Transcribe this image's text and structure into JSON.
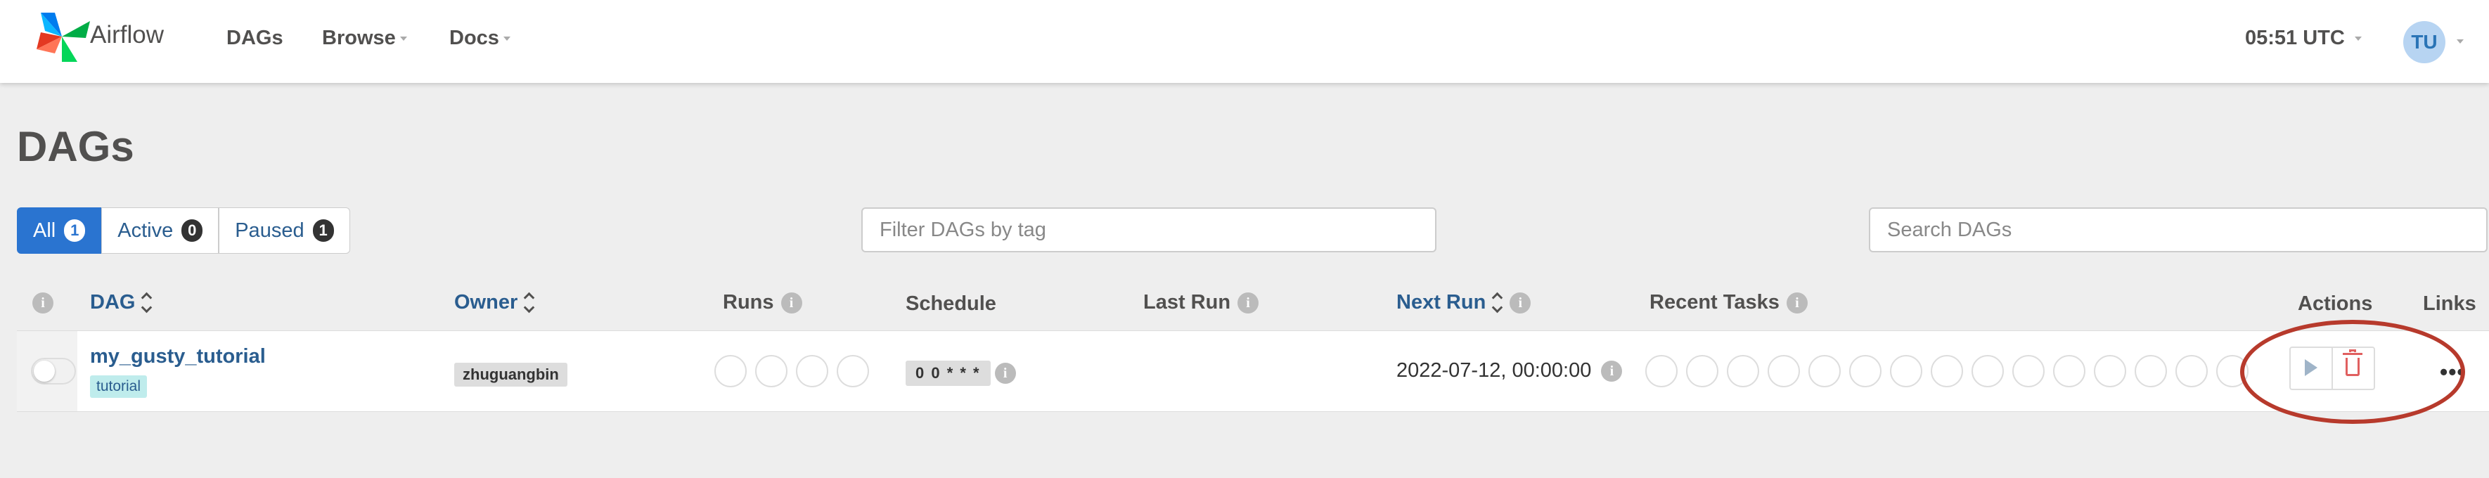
{
  "navbar": {
    "brand": "Airflow",
    "items": [
      {
        "label": "DAGs"
      },
      {
        "label": "Browse"
      },
      {
        "label": "Docs"
      }
    ],
    "time": "05:51 UTC",
    "user_initials": "TU"
  },
  "page": {
    "title": "DAGs"
  },
  "filters": {
    "all_label": "All",
    "all_count": "1",
    "active_label": "Active",
    "active_count": "0",
    "paused_label": "Paused",
    "paused_count": "1",
    "tag_placeholder": "Filter DAGs by tag",
    "search_placeholder": "Search DAGs"
  },
  "table": {
    "headers": {
      "dag": "DAG",
      "owner": "Owner",
      "runs": "Runs",
      "schedule": "Schedule",
      "last_run": "Last Run",
      "next_run": "Next Run",
      "recent_tasks": "Recent Tasks",
      "actions": "Actions",
      "links": "Links"
    },
    "rows": [
      {
        "dag_id": "my_gusty_tutorial",
        "tag": "tutorial",
        "owner": "zhuguangbin",
        "schedule": "0 0 * * *",
        "last_run": "",
        "next_run": "2022-07-12, 00:00:00",
        "links": "•••"
      }
    ]
  },
  "colors": {
    "primary": "#2a74d0",
    "link": "#2a5d8f",
    "highlight": "#b73a2c"
  }
}
